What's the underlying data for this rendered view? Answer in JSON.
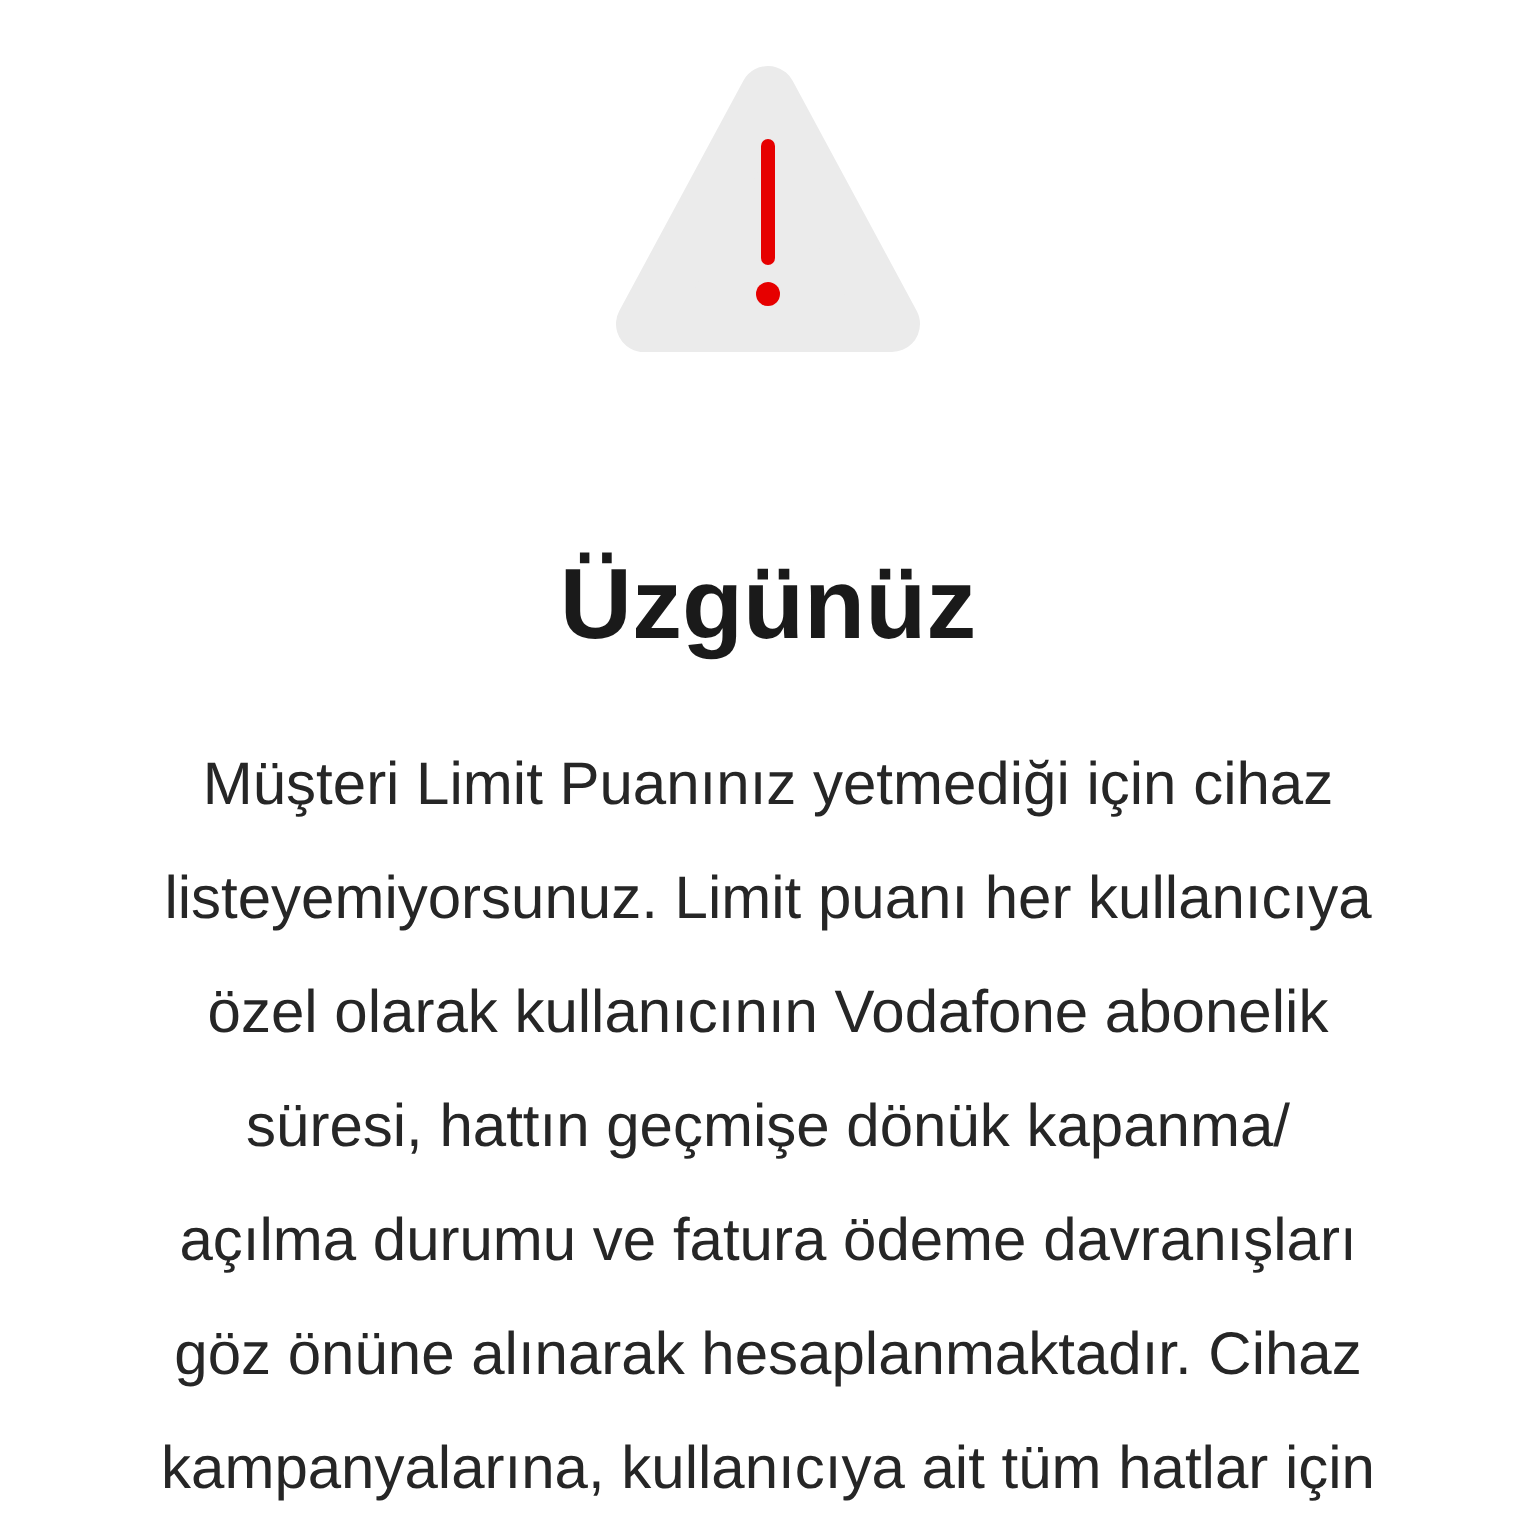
{
  "alert": {
    "title": "Üzgünüz",
    "message": "Müşteri Limit Puanınız yetmediği için cihaz\nlisteyemiyorsunuz. Limit puanı her kullanıcıya\nözel olarak kullanıcının Vodafone abonelik\nsüresi, hattın geçmişe dönük kapanma/\naçılma durumu ve fatura ödeme davranışları\ngöz önüne alınarak hesaplanmaktadır. Cihaz\nkampanyalarına, kullanıcıya ait tüm hatlar için"
  }
}
